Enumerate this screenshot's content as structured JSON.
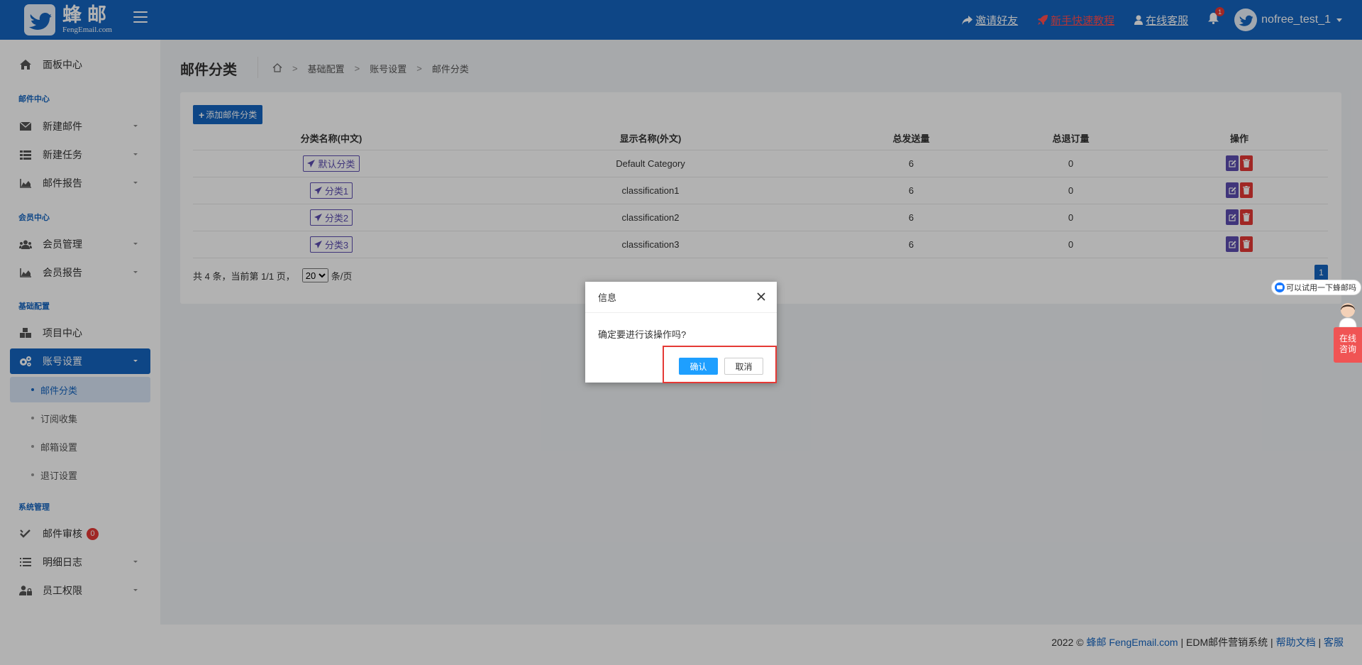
{
  "brand": {
    "name_cn": "蜂邮",
    "name_en": "FengEmail.com"
  },
  "header": {
    "links": [
      {
        "label": "邀请好友",
        "icon": "share-icon"
      },
      {
        "label": "新手快速教程",
        "icon": "rocket-icon",
        "color": "#ff4d4f"
      },
      {
        "label": "在线客服",
        "icon": "user-icon"
      }
    ],
    "notifications": "1",
    "username": "nofree_test_1"
  },
  "sidebar": {
    "dashboard": "面板中心",
    "sections": [
      "邮件中心",
      "会员中心",
      "基础配置",
      "系统管理"
    ],
    "items": [
      "新建邮件",
      "新建任务",
      "邮件报告",
      "会员管理",
      "会员报告",
      "项目中心",
      "账号设置",
      "邮件审核",
      "明细日志",
      "员工权限"
    ],
    "subitems": [
      "邮件分类",
      "订阅收集",
      "邮箱设置",
      "退订设置"
    ],
    "audit_badge": "0"
  },
  "page": {
    "title": "邮件分类",
    "breadcrumb": [
      "基础配置",
      "账号设置",
      "邮件分类"
    ]
  },
  "table": {
    "add_button": "添加邮件分类",
    "columns": [
      "分类名称(中文)",
      "显示名称(外文)",
      "总发送量",
      "总退订量",
      "操作"
    ],
    "rows": [
      {
        "name_cn": "默认分类",
        "name_foreign": "Default Category",
        "sent": "6",
        "unsubscribed": "0"
      },
      {
        "name_cn": "分类1",
        "name_foreign": "classification1",
        "sent": "6",
        "unsubscribed": "0"
      },
      {
        "name_cn": "分类2",
        "name_foreign": "classification2",
        "sent": "6",
        "unsubscribed": "0"
      },
      {
        "name_cn": "分类3",
        "name_foreign": "classification3",
        "sent": "6",
        "unsubscribed": "0"
      }
    ]
  },
  "pager": {
    "summary": "共 4 条，当前第 1/1 页，",
    "page_size": "20",
    "per_page_suffix": "条/页",
    "current_page": "1"
  },
  "footer": {
    "year": "2022 ©",
    "brand_cn": "蜂邮",
    "brand_en": "FengEmail.com",
    "sep": "|",
    "system": "EDM邮件营销系统",
    "help": "帮助文档",
    "support": "客服"
  },
  "chat": {
    "bubble": "可以试用一下蜂邮吗",
    "button_line1": "在线",
    "button_line2": "咨询"
  },
  "modal": {
    "title": "信息",
    "message": "确定要进行该操作吗?",
    "confirm": "确认",
    "cancel": "取消"
  },
  "colors": {
    "primary": "#1565c0",
    "danger": "#e53935",
    "purple": "#5c4db1",
    "confirm_blue": "#1e9fff"
  }
}
